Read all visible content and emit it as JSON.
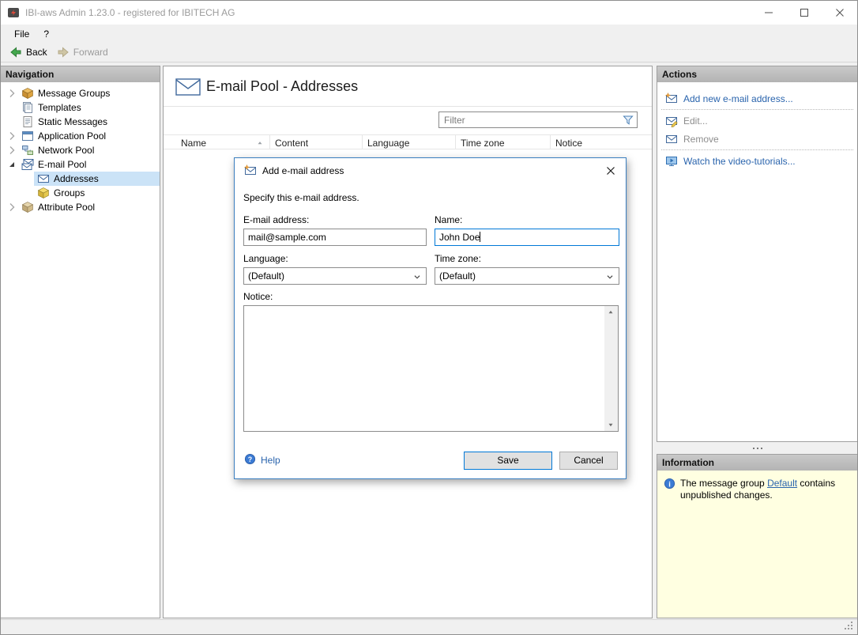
{
  "colors": {
    "dialog_border_blue": "#3a7ebf",
    "focus_blue": "#0078d7",
    "link_blue": "#2a64ad",
    "tree_selection_blue": "#cbe3f7",
    "panel_header_gray": "#bcbcbc",
    "info_background_yellow": "#ffffe1",
    "back_arrow_green": "#44a84e",
    "disabled_text_gray": "#8d8d8d"
  },
  "window": {
    "title": "IBI-aws Admin 1.23.0 - registered for IBITECH AG"
  },
  "menubar": {
    "items": [
      {
        "label": "File"
      },
      {
        "label": "?"
      }
    ]
  },
  "toolbar": {
    "back_label": "Back",
    "forward_label": "Forward"
  },
  "navigation": {
    "header": "Navigation",
    "items": [
      {
        "label": "Message Groups",
        "icon": "cube-orange-icon",
        "state": "collapsed",
        "level": 0
      },
      {
        "label": "Templates",
        "icon": "templates-icon",
        "level": 0
      },
      {
        "label": "Static Messages",
        "icon": "static-messages-icon",
        "level": 0
      },
      {
        "label": "Application Pool",
        "icon": "application-window-icon",
        "state": "collapsed",
        "level": 0
      },
      {
        "label": "Network Pool",
        "icon": "network-icon",
        "state": "collapsed",
        "level": 0
      },
      {
        "label": "E-mail Pool",
        "icon": "envelope-stack-icon",
        "state": "expanded",
        "level": 0
      },
      {
        "label": "Addresses",
        "icon": "envelope-icon",
        "level": 1,
        "selected": true
      },
      {
        "label": "Groups",
        "icon": "cube-yellow-icon",
        "level": 1
      },
      {
        "label": "Attribute Pool",
        "icon": "cube-tan-icon",
        "state": "collapsed",
        "level": 0
      }
    ]
  },
  "main": {
    "title": "E-mail Pool - Addresses",
    "title_icon": "envelope-large-icon",
    "filter": {
      "placeholder": "Filter",
      "icon": "filter-funnel-icon"
    },
    "table": {
      "columns": [
        {
          "label": "Name",
          "sort": "asc"
        },
        {
          "label": "Content"
        },
        {
          "label": "Language"
        },
        {
          "label": "Time zone"
        },
        {
          "label": "Notice"
        }
      ],
      "rows": []
    }
  },
  "dialog": {
    "title": "Add e-mail address",
    "title_icon": "envelope-add-icon",
    "description": "Specify this e-mail address.",
    "fields": {
      "email": {
        "label": "E-mail address:",
        "value": "mail@sample.com"
      },
      "name": {
        "label": "Name:",
        "value": "John Doe",
        "focused": true
      },
      "language": {
        "label": "Language:",
        "value": "(Default)"
      },
      "timezone": {
        "label": "Time zone:",
        "value": "(Default)"
      },
      "notice": {
        "label": "Notice:",
        "value": ""
      }
    },
    "buttons": {
      "help": "Help",
      "save": "Save",
      "cancel": "Cancel"
    }
  },
  "actions": {
    "header": "Actions",
    "items": [
      {
        "label": "Add new e-mail address...",
        "icon": "envelope-add-icon",
        "enabled": true
      },
      {
        "label": "Edit...",
        "icon": "envelope-edit-icon",
        "enabled": false
      },
      {
        "label": "Remove",
        "icon": "envelope-remove-icon",
        "enabled": false
      },
      {
        "label": "Watch the video-tutorials...",
        "icon": "video-tutorial-icon",
        "enabled": true
      }
    ]
  },
  "information": {
    "header": "Information",
    "icon": "info-icon",
    "text_before": "The message group ",
    "link_text": "Default",
    "text_after": " contains unpublished changes."
  }
}
